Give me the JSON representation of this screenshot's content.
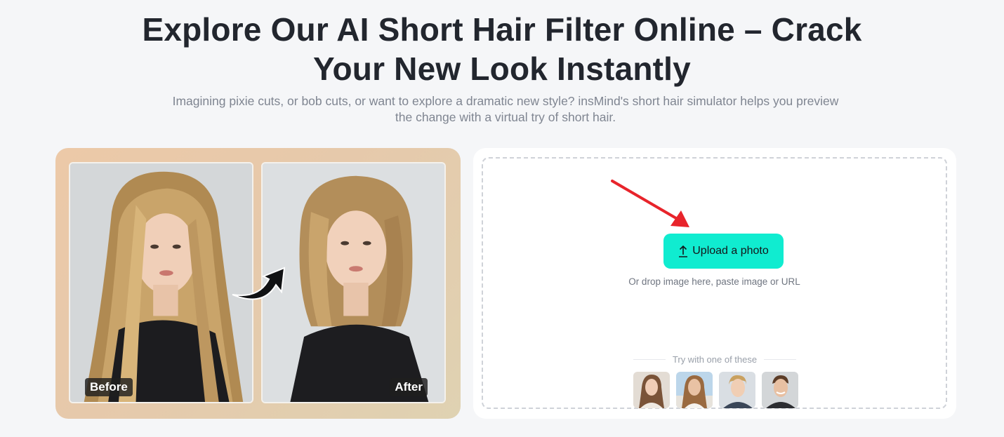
{
  "hero": {
    "title_line1": "Explore Our AI Short Hair Filter Online – Crack",
    "title_line2": "Your New Look Instantly",
    "subtitle_line1": "Imagining pixie cuts, or bob cuts, or want to explore a dramatic new style? insMind's short hair simulator helps you preview",
    "subtitle_line2": "the change with a virtual try of short hair."
  },
  "demo": {
    "before_label": "Before",
    "after_label": "After"
  },
  "upload": {
    "button_label": "Upload a photo",
    "drop_hint": "Or drop image here, paste image or URL",
    "samples_heading": "Try with one of these",
    "samples": [
      "sample-woman-brown-hair",
      "sample-woman-beach",
      "sample-man-blond",
      "sample-man-smiling"
    ]
  },
  "colors": {
    "accent": "#10ecd0",
    "annotation_arrow": "#e8242b"
  }
}
